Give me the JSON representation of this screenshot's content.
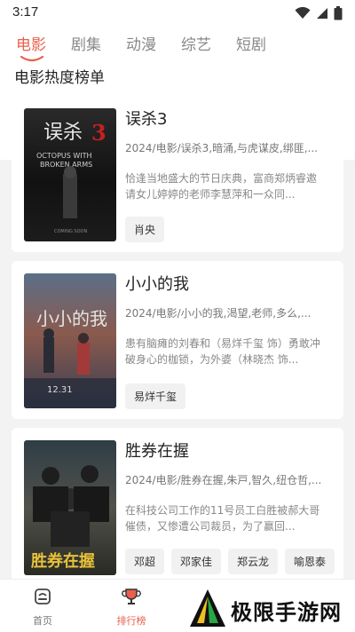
{
  "status": {
    "time": "3:17"
  },
  "tabs": [
    {
      "label": "电影",
      "active": true
    },
    {
      "label": "剧集",
      "active": false
    },
    {
      "label": "动漫",
      "active": false
    },
    {
      "label": "综艺",
      "active": false
    },
    {
      "label": "短剧",
      "active": false
    }
  ],
  "section_title": "电影热度榜单",
  "movies": [
    {
      "title": "误杀3",
      "meta": "2024/电影/误杀3,暗涌,与虎谋皮,绑匪,...",
      "desc": "恰逢当地盛大的节日庆典，富商郑炳睿邀请女儿婷婷的老师李慧萍和一众同...",
      "actors": [
        "肖央"
      ],
      "poster_text": "误杀3"
    },
    {
      "title": "小小的我",
      "meta": "2024/电影/小小的我,渴望,老师,多么,...",
      "desc": "患有脑瘫的刘春和（易烊千玺 饰）勇敢冲破身心的枷锁，为外婆（林晓杰 饰...",
      "actors": [
        "易烊千玺"
      ],
      "poster_text": "小小的我"
    },
    {
      "title": "胜券在握",
      "meta": "2024/电影/胜券在握,朱戸,智久,纽仓哲,...",
      "desc": "在科技公司工作的11号员工白胜被郝大哥催债，又惨遭公司裁员，为了赢回...",
      "actors": [
        "邓超",
        "邓家佳",
        "郑云龙",
        "喻恩泰"
      ],
      "poster_text": "胜券在握"
    }
  ],
  "bottom_nav": [
    {
      "label": "首页",
      "icon": "home-icon",
      "active": false
    },
    {
      "label": "排行榜",
      "icon": "trophy-icon",
      "active": true
    }
  ],
  "watermark": {
    "text": "极限手游网"
  },
  "colors": {
    "accent": "#e8604c",
    "background": "#f3f3f3"
  }
}
